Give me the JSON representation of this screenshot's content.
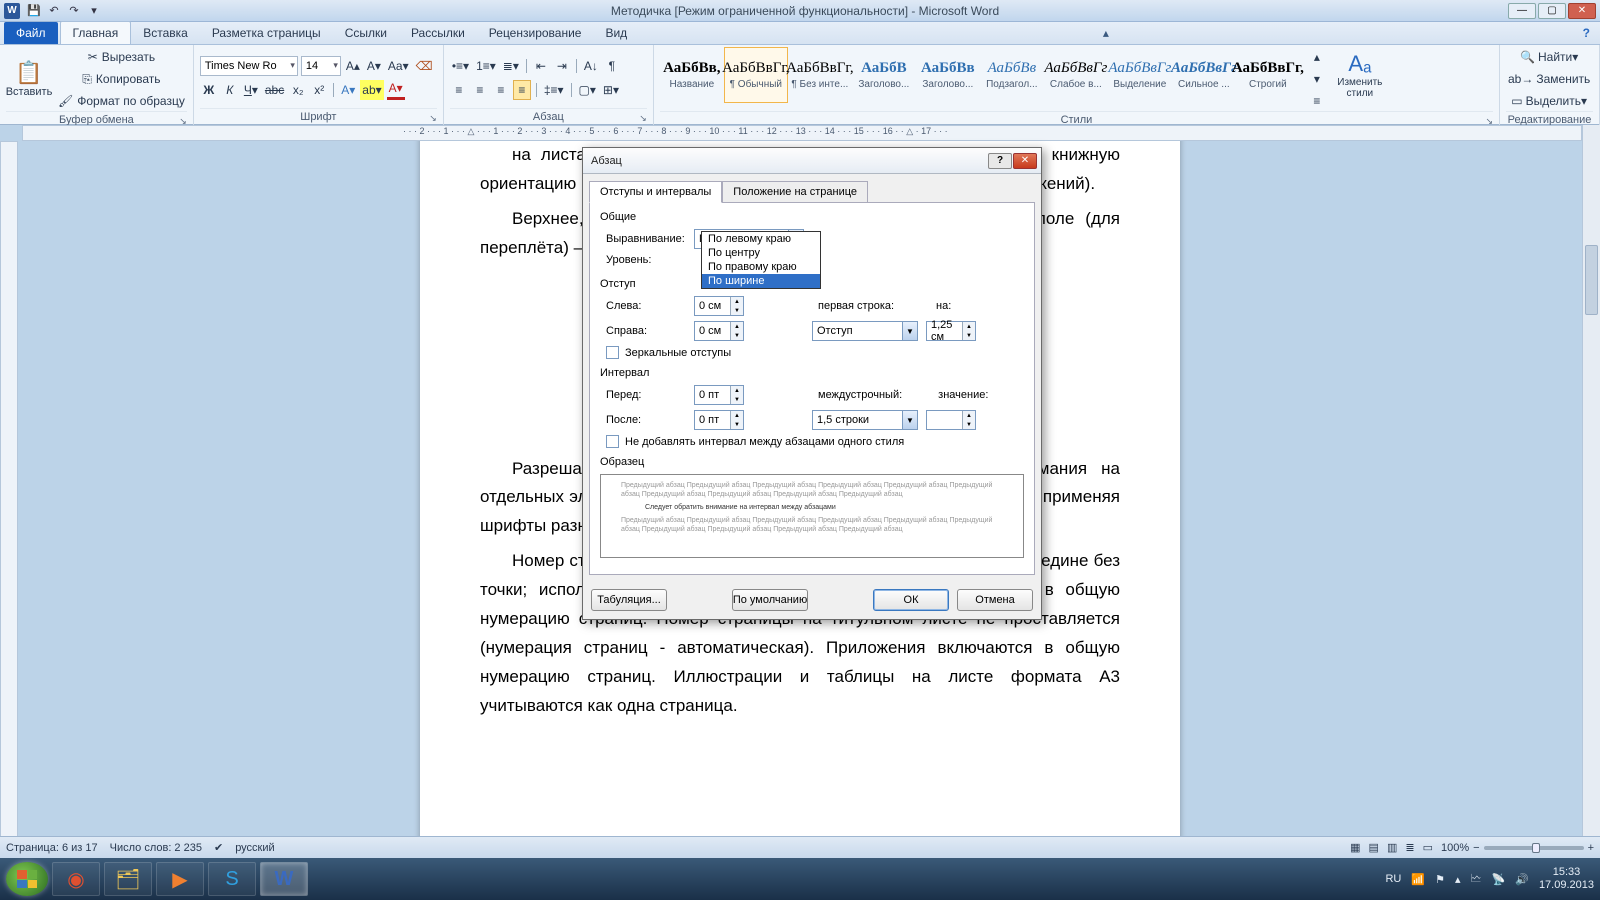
{
  "title": "Методичка [Режим ограниченной функциональности] - Microsoft Word",
  "ribbon": {
    "file": "Файл",
    "tabs": [
      "Главная",
      "Вставка",
      "Разметка страницы",
      "Ссылки",
      "Рассылки",
      "Рецензирование",
      "Вид"
    ],
    "active_tab": "Главная",
    "groups": {
      "clipboard": {
        "label": "Буфер обмена",
        "paste": "Вставить",
        "cut": "Вырезать",
        "copy": "Копировать",
        "format_painter": "Формат по образцу"
      },
      "font": {
        "label": "Шрифт",
        "family": "Times New Ro",
        "size": "14"
      },
      "paragraph": {
        "label": "Абзац"
      },
      "styles": {
        "label": "Стили",
        "items": [
          {
            "sample": "АаБбВв,",
            "name": "Название",
            "cls": "bold"
          },
          {
            "sample": "АаБбВвГг,",
            "name": "¶ Обычный",
            "cls": ""
          },
          {
            "sample": "АаБбВвГг,",
            "name": "¶ Без инте...",
            "cls": ""
          },
          {
            "sample": "АаБбВ",
            "name": "Заголово...",
            "cls": "blue bold"
          },
          {
            "sample": "АаБбВв",
            "name": "Заголово...",
            "cls": "blue bold"
          },
          {
            "sample": "АаБбВв",
            "name": "Подзагол...",
            "cls": "blue it"
          },
          {
            "sample": "АаБбВвГг",
            "name": "Слабое в...",
            "cls": "it"
          },
          {
            "sample": "АаБбВвГг",
            "name": "Выделение",
            "cls": "blue it"
          },
          {
            "sample": "АаБбВвГг",
            "name": "Сильное ...",
            "cls": "blue it bold"
          },
          {
            "sample": "АаБбВвГг,",
            "name": "Строгий",
            "cls": "bold"
          }
        ],
        "change_styles": "Изменить стили"
      },
      "editing": {
        "label": "Редактирование",
        "find": "Найти",
        "replace": "Заменить",
        "select": "Выделить"
      }
    }
  },
  "ruler_text": "· · · 2 · · · 1 · · · △ · · · 1 · · · 2 · · · 3 · · · 4 · · · 5 · · · 6 · · · 7 · · · 8 · · · 9 · · · 10 · · · 11 · · · 12 · · · 13 · · · 14 · · · 15 · · · 16 · · △ · 17 · · ·",
  "doc": {
    "p1": "на листах формата А4 с одной стороны. Текст должен иметь книжную ориентацию (альбомная допускается только для таблиц и схем приложений).",
    "p2": "Верхнее, нижнее и правое поле — шириной 15 мм, левое поле (для переплёта) — 30 мм.",
    "p3": "Разрешается использовать возможности акцентирования внимания на отдельных элементах работы (названиях глав, важнейших терминах), применяя шрифты разной гарнитуры.",
    "p4": "Номер страницы проставляют в правой нижней части листа посередине без точки; используют арабские цифры. Титульный лист включается в общую нумерацию страниц. Номер страницы на титульном листе не проставляется (нумерация страниц - автоматическая). Приложения включаются в общую нумерацию страниц. Иллюстрации и таблицы на листе формата А3 учитываются как одна страница."
  },
  "dialog": {
    "title": "Абзац",
    "tabs": [
      "Отступы и интервалы",
      "Положение на странице"
    ],
    "sections": {
      "general": "Общие",
      "indent": "Отступ",
      "spacing": "Интервал",
      "preview": "Образец"
    },
    "labels": {
      "alignment": "Выравнивание:",
      "level": "Уровень:",
      "left": "Слева:",
      "right": "Справа:",
      "first_line": "первая строка:",
      "by": "на:",
      "before": "Перед:",
      "after": "После:",
      "line_spacing": "междустрочный:",
      "at": "значение:",
      "mirror": "Зеркальные отступы",
      "no_space": "Не добавлять интервал между абзацами одного стиля"
    },
    "values": {
      "alignment": "По ширине",
      "left": "0 см",
      "right": "0 см",
      "first_line": "Отступ",
      "by": "1,25 см",
      "before": "0 пт",
      "after": "0 пт",
      "line_spacing": "1,5 строки",
      "at": ""
    },
    "alignment_options": [
      "По левому краю",
      "По центру",
      "По правому краю",
      "По ширине"
    ],
    "preview_gray": "Предыдущий абзац Предыдущий абзац Предыдущий абзац Предыдущий абзац Предыдущий абзац Предыдущий абзац Предыдущий абзац Предыдущий абзац Предыдущий абзац Предыдущий абзац",
    "preview_dark": "Следует обратить внимание на интервал между абзацами",
    "buttons": {
      "tabs": "Табуляция...",
      "default": "По умолчанию",
      "ok": "ОК",
      "cancel": "Отмена"
    }
  },
  "status": {
    "page": "Страница: 6 из 17",
    "words": "Число слов: 2 235",
    "lang": "русский",
    "zoom": "100%"
  },
  "tray": {
    "lang": "RU",
    "time": "15:33",
    "date": "17.09.2013"
  }
}
